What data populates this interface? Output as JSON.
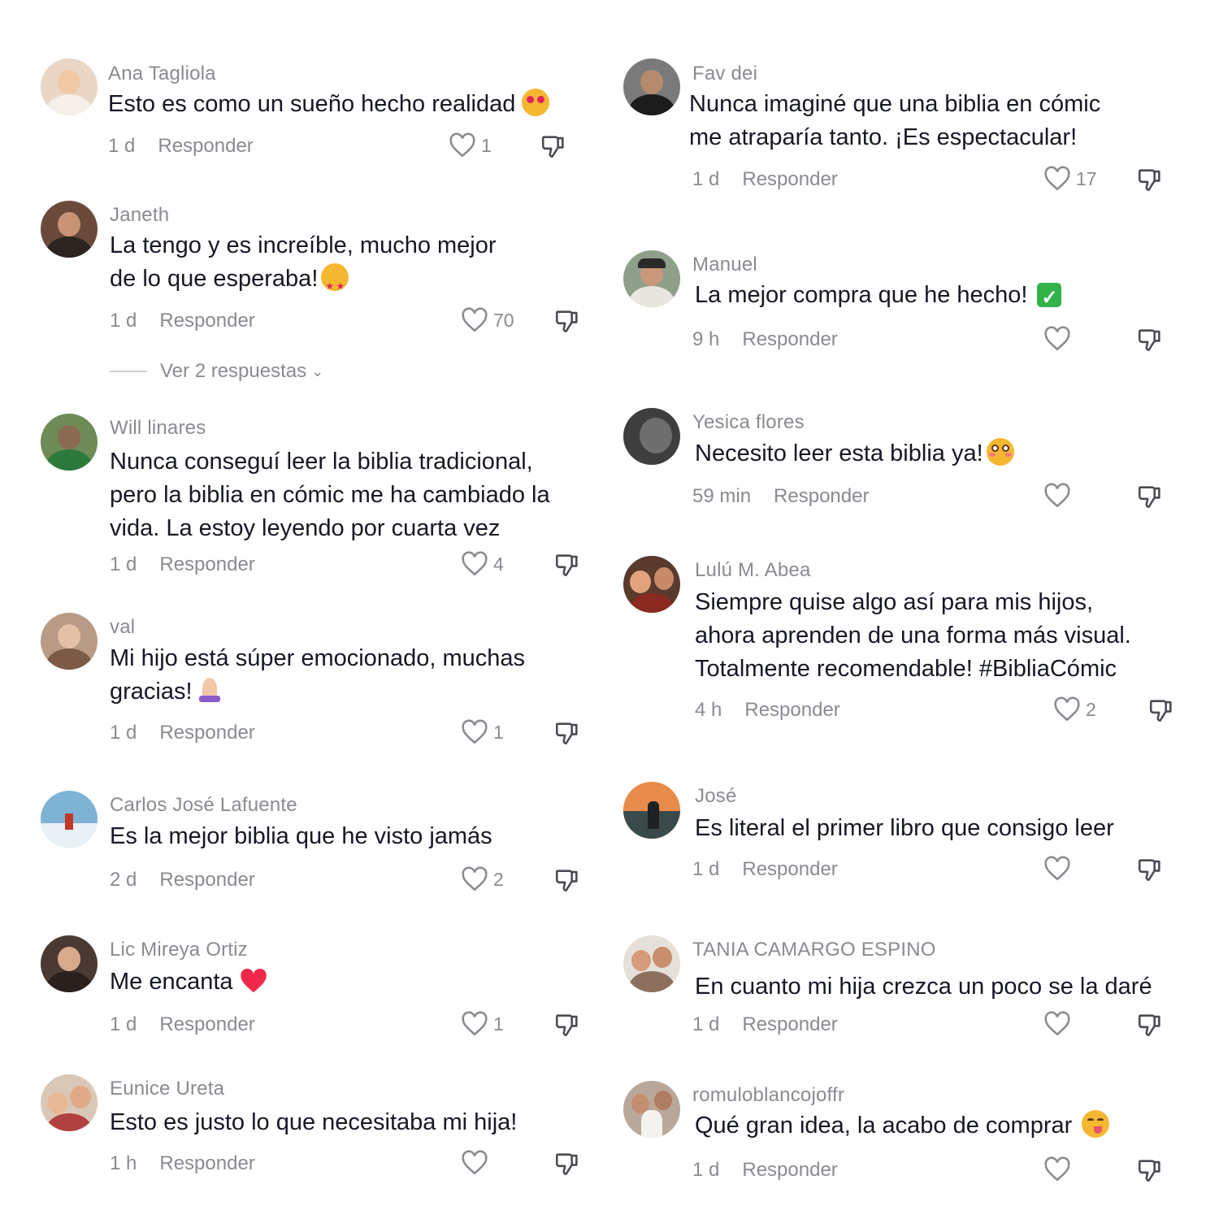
{
  "reply_label": "Responder",
  "colors": {
    "muted": "#8a8b91",
    "text": "#161823",
    "heart_outline": "#8a8b91"
  },
  "icons": {
    "like": "heart-outline-icon",
    "dislike": "thumbs-down-icon"
  },
  "left_column": [
    {
      "username": "Ana Tagliola",
      "lines": [
        "Esto es como un sueño hecho realidad"
      ],
      "emoji": "heart-eyes-emoji",
      "time": "1 d",
      "likes": "1"
    },
    {
      "username": "Janeth",
      "lines": [
        "La tengo y es increíble, mucho mejor",
        "de lo que esperaba!"
      ],
      "emoji": "star-struck-emoji",
      "time": "1 d",
      "likes": "70",
      "view_replies": "Ver 2 respuestas"
    },
    {
      "username": "Will linares",
      "lines": [
        "Nunca conseguí leer la biblia tradicional,",
        "pero la biblia en cómic me ha cambiado la",
        "vida. La estoy leyendo por cuarta vez"
      ],
      "time": "1 d",
      "likes": "4"
    },
    {
      "username": "val",
      "lines": [
        "Mi hijo está súper emocionado, muchas",
        "gracias!"
      ],
      "emoji": "praying-hands-emoji",
      "time": "1 d",
      "likes": "1"
    },
    {
      "username": "Carlos José Lafuente",
      "lines": [
        "Es la mejor biblia que he visto jamás"
      ],
      "time": "2 d",
      "likes": "2"
    },
    {
      "username": "Lic Mireya Ortiz",
      "lines": [
        "Me encanta"
      ],
      "emoji": "red-heart-emoji",
      "time": "1 d",
      "likes": "1"
    },
    {
      "username": "Eunice Ureta",
      "lines": [
        "Esto es justo lo que necesitaba mi hija!"
      ],
      "time": "1 h",
      "likes": ""
    }
  ],
  "right_column": [
    {
      "username": "Fav dei",
      "lines": [
        "Nunca imaginé que una biblia en cómic",
        "me atraparía tanto. ¡Es espectacular!"
      ],
      "time": "1 d",
      "likes": "17"
    },
    {
      "username": "Manuel",
      "lines": [
        "La mejor compra que he hecho!"
      ],
      "emoji": "check-mark-button-emoji",
      "time": "9 h",
      "likes": ""
    },
    {
      "username": "Yesica flores",
      "lines": [
        "Necesito leer esta biblia ya!"
      ],
      "emoji": "flushed-face-emoji",
      "time": "59 min",
      "likes": ""
    },
    {
      "username": "Lulú M. Abea",
      "lines": [
        "Siempre quise algo así para mis hijos,",
        "ahora aprenden de una forma más visual.",
        "Totalmente recomendable! #BibliaCómic"
      ],
      "time": "4 h",
      "likes": "2"
    },
    {
      "username": "José",
      "lines": [
        "Es literal el primer libro que consigo leer"
      ],
      "time": "1 d",
      "likes": ""
    },
    {
      "username": "TANIA CAMARGO ESPINO",
      "lines": [
        "En cuanto mi hija crezca un poco se la daré"
      ],
      "time": "1 d",
      "likes": ""
    },
    {
      "username": "romuloblancojoffr",
      "lines": [
        "Qué gran idea, la acabo de comprar"
      ],
      "emoji": "savoring-face-emoji",
      "time": "1 d",
      "likes": ""
    }
  ]
}
